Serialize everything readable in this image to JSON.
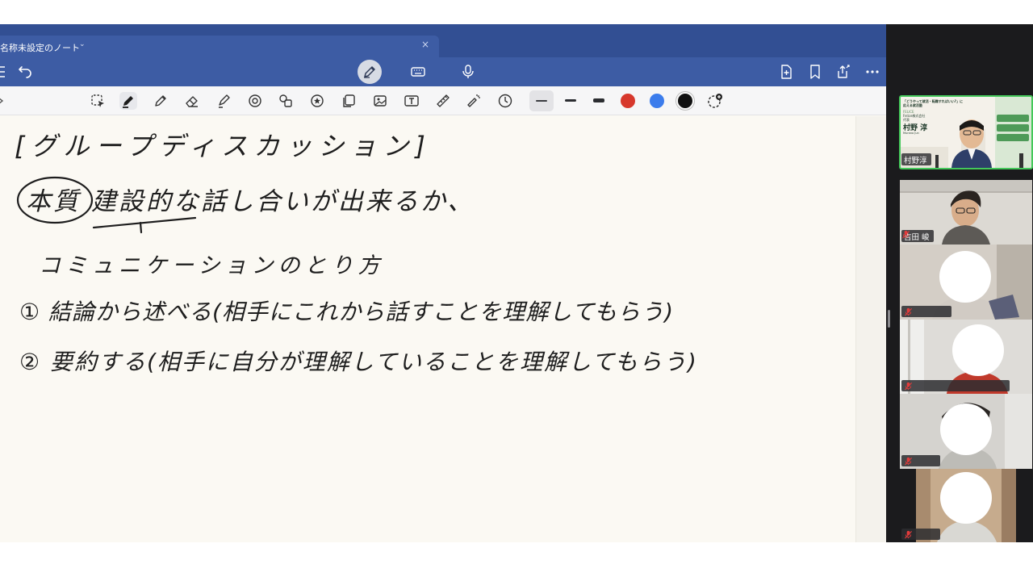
{
  "app": {
    "tab_title": "名称未設定のノート",
    "tab_chevron": "⌄",
    "tab_close": "×"
  },
  "colors": {
    "tabbar_bg": "#324f93",
    "mainbar_bg": "#3d5ca4",
    "paper": "#fbf9f3",
    "ink": "#1e1e1e",
    "swatch_red": "#d7382c",
    "swatch_blue": "#3b7cec",
    "swatch_black": "#111111",
    "active_speaker": "#44c85a"
  },
  "toolbar": {
    "tools": [
      "lasso-select",
      "pen",
      "pencil",
      "eraser",
      "highlighter",
      "shapes",
      "elements",
      "sticker",
      "copy",
      "image",
      "text-box",
      "ruler",
      "laser-pointer",
      "history"
    ],
    "selected_tool": "pen",
    "stroke_widths": [
      "thin",
      "medium",
      "thick"
    ],
    "selected_width": "thin",
    "colors": [
      "red",
      "blue",
      "black"
    ],
    "selected_color": "black"
  },
  "note": {
    "lines": [
      "[グループディスカッション]",
      "本質 建設的な話し合いが出来るか、",
      "コミュニケーションのとり方",
      "① 結論から述べる(相手にこれから話すことを理解してもらう)",
      "② 要約する(相手に自分が理解していることを理解してもらう)"
    ]
  },
  "participants": [
    {
      "name": "村野淳",
      "speaking": true,
      "slide": {
        "headline_1": "「どうやって就活・転職すればいい?」に",
        "headline_2": "応える就活塾",
        "company": "FELICE",
        "company_sub": "Felice株式会社",
        "role": "代表",
        "person": "村野 淳",
        "person_roman": "Murano Jun"
      }
    },
    {
      "name": "吉田 峻",
      "speaking": false
    },
    {
      "name": "",
      "speaking": false
    },
    {
      "name": "",
      "speaking": false
    },
    {
      "name": "",
      "speaking": false
    },
    {
      "name": "",
      "speaking": false
    }
  ]
}
